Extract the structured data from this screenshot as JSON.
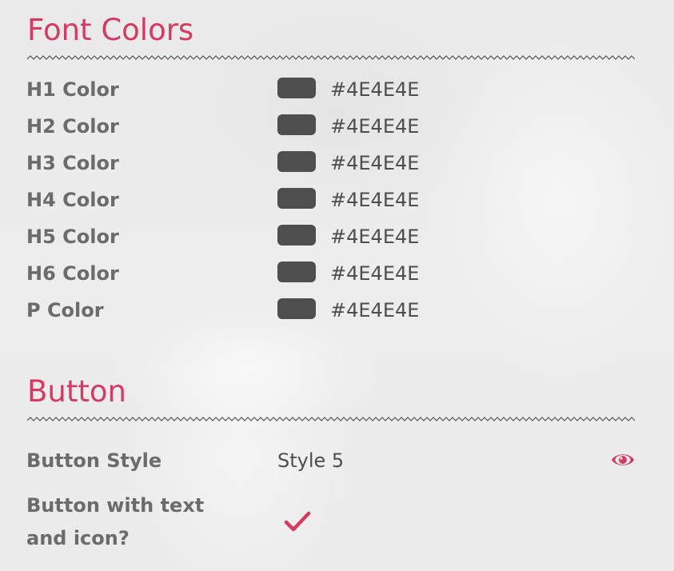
{
  "font_colors": {
    "title": "Font Colors",
    "rows": [
      {
        "label": "H1 Color",
        "value": "#4E4E4E"
      },
      {
        "label": "H2 Color",
        "value": "#4E4E4E"
      },
      {
        "label": "H3 Color",
        "value": "#4E4E4E"
      },
      {
        "label": "H4 Color",
        "value": "#4E4E4E"
      },
      {
        "label": "H5 Color",
        "value": "#4E4E4E"
      },
      {
        "label": "H6 Color",
        "value": "#4E4E4E"
      },
      {
        "label": "P Color",
        "value": "#4E4E4E"
      }
    ]
  },
  "button": {
    "title": "Button",
    "style_label": "Button Style",
    "style_value": "Style 5",
    "preview_icon": "eye-icon",
    "text_icon_label": "Button with text and icon?",
    "text_icon_checked": true,
    "check_icon": "check-icon"
  },
  "colors": {
    "accent": "#d63964",
    "label": "#6b6b6b",
    "value": "#4e4e4e"
  }
}
